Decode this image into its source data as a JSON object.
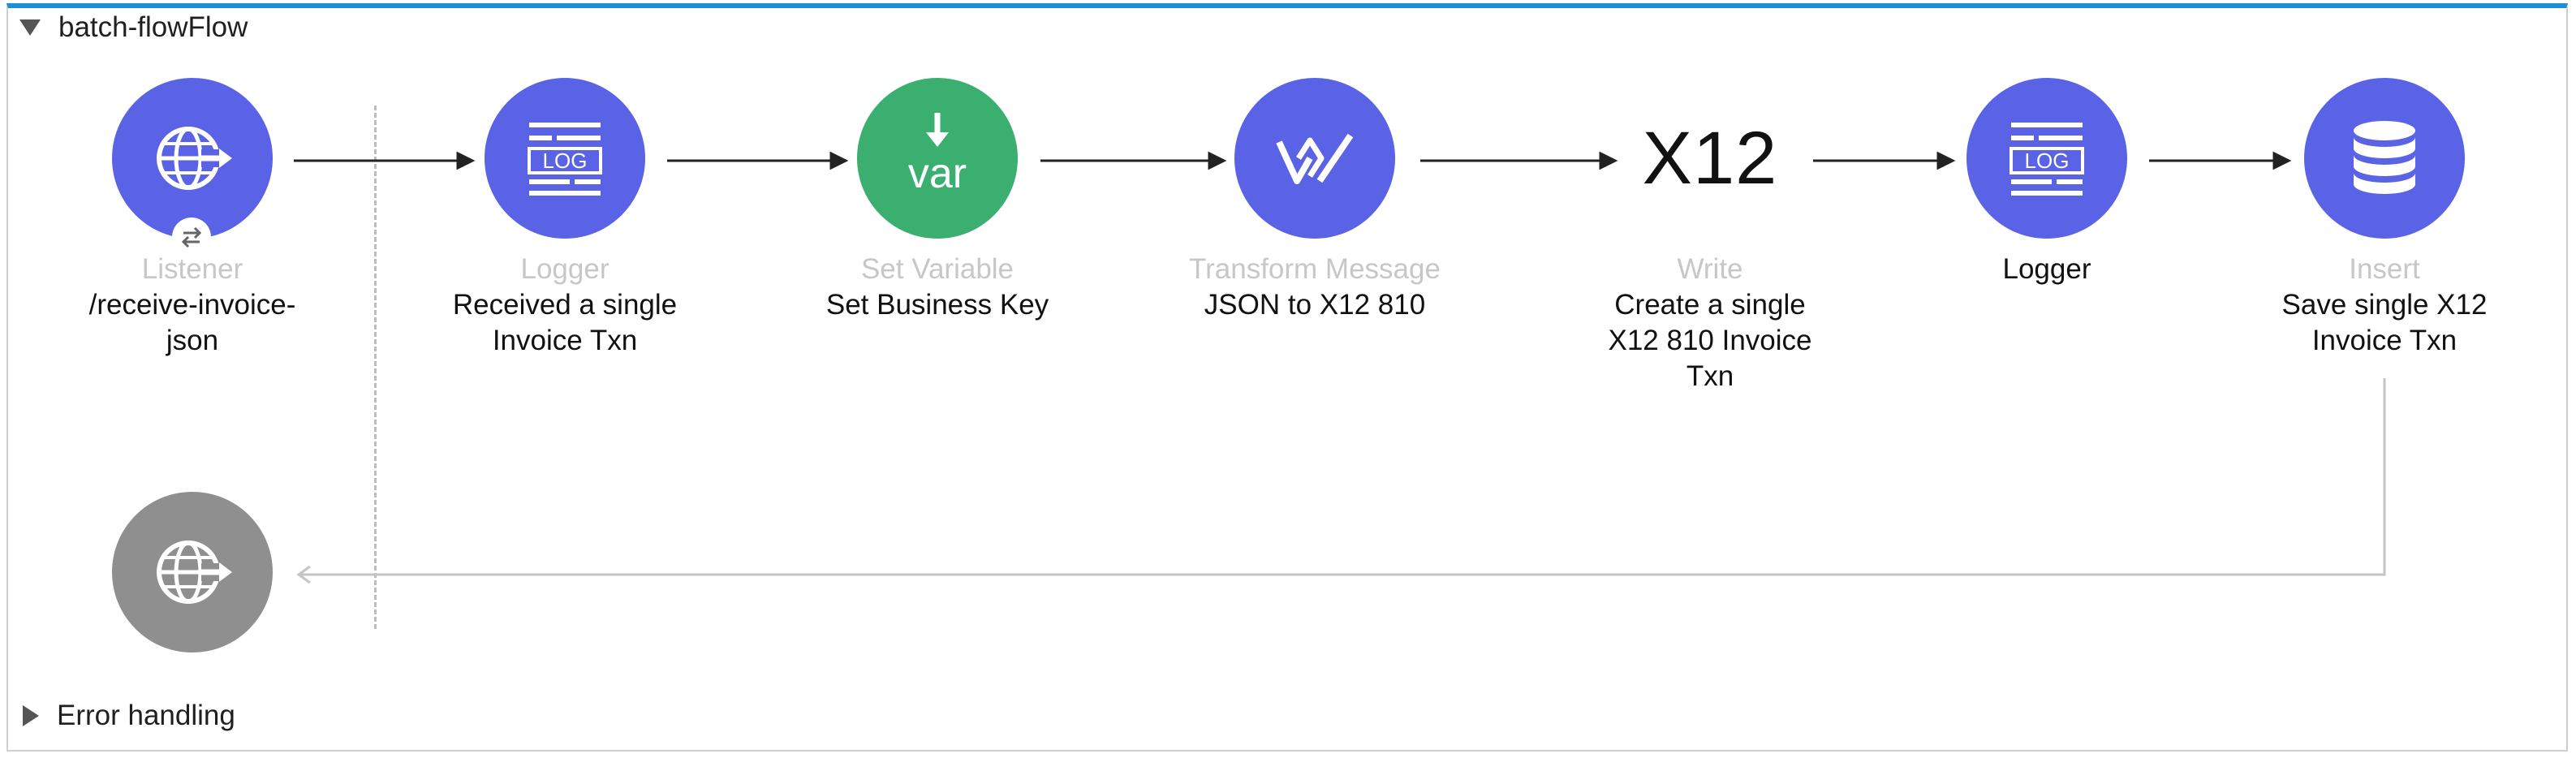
{
  "flow": {
    "title": "batch-flowFlow",
    "error_handling": "Error handling"
  },
  "nodes": [
    {
      "type": "Listener",
      "name": "/receive-invoice-\njson",
      "icon": "globe-arrow-icon",
      "color": "#5a63e6"
    },
    {
      "type": "Logger",
      "name": "Received a single\nInvoice Txn",
      "icon": "log-icon",
      "color": "#5a63e6"
    },
    {
      "type": "Set Variable",
      "name": "Set Business Key",
      "icon": "var-icon",
      "color": "#3aaf6f"
    },
    {
      "type": "Transform Message",
      "name": "JSON to X12 810",
      "icon": "transform-icon",
      "color": "#5a63e6"
    },
    {
      "type": "Write",
      "name": "Create a single\nX12 810 Invoice\nTxn",
      "icon": "x12-icon",
      "icon_text": "X12"
    },
    {
      "type": "",
      "name": "Logger",
      "icon": "log-icon",
      "color": "#5a63e6"
    },
    {
      "type": "Insert",
      "name": "Save single X12\nInvoice Txn",
      "icon": "database-icon",
      "color": "#5a63e6"
    }
  ],
  "response_node": {
    "icon": "globe-arrow-icon",
    "color": "#8f8f8f"
  },
  "colors": {
    "accent": "#1b8fd6",
    "node_blue": "#5a63e6",
    "node_green": "#3aaf6f",
    "node_gray": "#8f8f8f"
  }
}
